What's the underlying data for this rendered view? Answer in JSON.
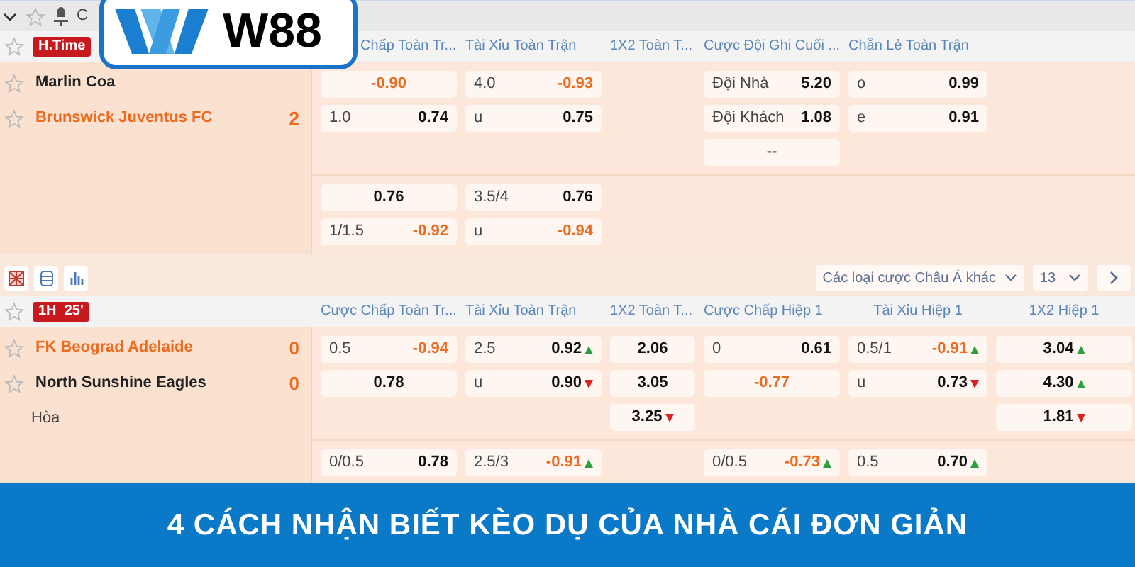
{
  "logo": {
    "text": "W88"
  },
  "sections": [
    {
      "toolbar": {
        "kind": "top",
        "label": "C"
      },
      "badge": "H.Time",
      "headers": [
        "Chấp Toàn Tr...",
        "Tài Xỉu Toàn Trận",
        "1X2 Toàn T...",
        "Cược Đội Ghi Cuối ...",
        "Chẵn Lẻ Toàn Trận"
      ],
      "teams": [
        {
          "kind": "team",
          "name": "Marlin Coa",
          "favorite": false
        },
        {
          "kind": "team",
          "name": "Brunswick Juventus FC",
          "favorite": true,
          "score": "2"
        }
      ],
      "groups": [
        {
          "rows": [
            {
              "cells": [
                {
                  "odds": "-0.90",
                  "color": "#ee6a1f"
                },
                {
                  "line": "4.0",
                  "odds": "-0.93",
                  "color": "#ee6a1f"
                },
                null,
                {
                  "line": "Đội Nhà",
                  "odds": "5.20",
                  "color": "#111111"
                },
                {
                  "line": "o",
                  "odds": "0.99",
                  "color": "#111111"
                },
                null
              ]
            },
            {
              "cells": [
                {
                  "line": "1.0",
                  "odds": "0.74",
                  "color": "#111111"
                },
                {
                  "line": "u",
                  "odds": "0.75",
                  "color": "#111111"
                },
                null,
                {
                  "line": "Đội Khách",
                  "odds": "1.08",
                  "color": "#111111"
                },
                {
                  "line": "e",
                  "odds": "0.91",
                  "color": "#111111"
                },
                null
              ]
            },
            {
              "cells": [
                null,
                null,
                null,
                {
                  "odds": "--",
                  "color": "#888888"
                },
                null,
                null
              ]
            }
          ]
        },
        {
          "rows": [
            {
              "cells": [
                {
                  "odds": "0.76",
                  "color": "#111111"
                },
                {
                  "line": "3.5/4",
                  "odds": "0.76",
                  "color": "#111111"
                },
                null,
                null,
                null,
                null
              ]
            },
            {
              "cells": [
                {
                  "line": "1/1.5",
                  "odds": "-0.92",
                  "color": "#ee6a1f"
                },
                {
                  "line": "u",
                  "odds": "-0.94",
                  "color": "#ee6a1f"
                },
                null,
                null,
                null,
                null
              ]
            }
          ]
        }
      ]
    },
    {
      "toolbar": {
        "kind": "filters",
        "dropdown": "Các loại cược Châu Á khác",
        "count": "13"
      },
      "badge": "1H  25'",
      "headers": [
        "Cược Chấp Toàn Tr...",
        "Tài Xỉu Toàn Trận",
        "1X2 Toàn T...",
        "Cược Chấp Hiệp 1",
        "Tài Xỉu Hiệp 1",
        "1X2 Hiệp 1"
      ],
      "teams": [
        {
          "kind": "team",
          "name": "FK Beograd Adelaide",
          "favorite": true,
          "score": "0"
        },
        {
          "kind": "team",
          "name": "North Sunshine Eagles",
          "favorite": false,
          "score": "0"
        },
        {
          "kind": "draw",
          "name": "Hòa"
        }
      ],
      "groups": [
        {
          "rows": [
            {
              "cells": [
                {
                  "line": "0.5",
                  "odds": "-0.94",
                  "color": "#ee6a1f"
                },
                {
                  "line": "2.5",
                  "odds": "0.92",
                  "color": "#111111",
                  "rising": true
                },
                {
                  "odds": "2.06",
                  "color": "#111111"
                },
                {
                  "line": "0",
                  "odds": "0.61",
                  "color": "#111111"
                },
                {
                  "line": "0.5/1",
                  "odds": "-0.91",
                  "color": "#ee6a1f",
                  "rising": true
                },
                {
                  "odds": "3.04",
                  "color": "#111111",
                  "rising": true
                }
              ]
            },
            {
              "cells": [
                {
                  "odds": "0.78",
                  "color": "#111111"
                },
                {
                  "line": "u",
                  "odds": "0.90",
                  "color": "#111111",
                  "rising": false
                },
                {
                  "odds": "3.05",
                  "color": "#111111"
                },
                {
                  "odds": "-0.77",
                  "color": "#ee6a1f"
                },
                {
                  "line": "u",
                  "odds": "0.73",
                  "color": "#111111",
                  "rising": false
                },
                {
                  "odds": "4.30",
                  "color": "#111111",
                  "rising": true
                }
              ]
            },
            {
              "cells": [
                null,
                null,
                {
                  "odds": "3.25",
                  "color": "#111111",
                  "rising": false
                },
                null,
                null,
                {
                  "odds": "1.81",
                  "color": "#111111",
                  "rising": false
                }
              ]
            }
          ]
        },
        {
          "rows": [
            {
              "cells": [
                {
                  "line": "0/0.5",
                  "odds": "0.78",
                  "color": "#111111"
                },
                {
                  "line": "2.5/3",
                  "odds": "-0.91",
                  "color": "#ee6a1f",
                  "rising": true
                },
                null,
                {
                  "line": "0/0.5",
                  "odds": "-0.73",
                  "color": "#ee6a1f",
                  "rising": true
                },
                {
                  "line": "0.5",
                  "odds": "0.70",
                  "color": "#111111",
                  "rising": true
                },
                null
              ]
            }
          ]
        }
      ]
    }
  ],
  "banner": {
    "title": "4 CÁCH NHẬN BIẾT KÈO DỤ CỦA NHÀ CÁI ĐƠN GIẢN"
  }
}
